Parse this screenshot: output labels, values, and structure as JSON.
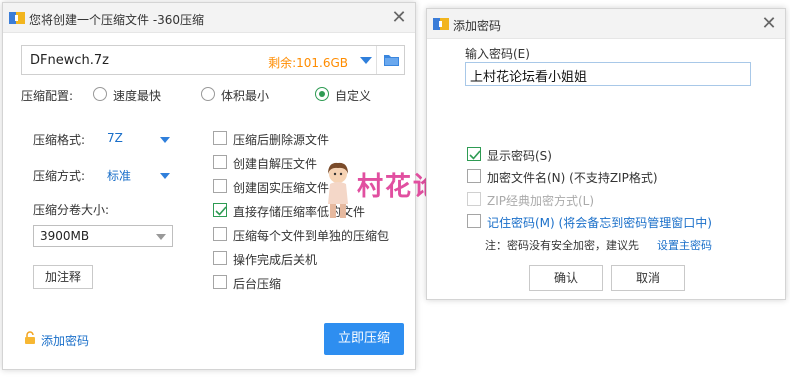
{
  "compress_dialog": {
    "title": "您将创建一个压缩文件 -360压缩",
    "path_value": "DFnewch.7z",
    "free_space": "剩余:101.6GB",
    "config_label": "压缩配置:",
    "radio_options": [
      "速度最快",
      "体积最小",
      "自定义"
    ],
    "radio_selected": "自定义",
    "format_label": "压缩格式:",
    "format_value": "7Z",
    "method_label": "压缩方式:",
    "method_value": "标准",
    "volume_label": "压缩分卷大小:",
    "volume_value": "3900MB",
    "comment_button": "加注释",
    "options": [
      {
        "label": "压缩后删除源文件",
        "checked": false
      },
      {
        "label": "创建自解压文件",
        "checked": false
      },
      {
        "label": "创建固实压缩文件",
        "checked": false
      },
      {
        "label": "直接存储压缩率低的文件",
        "checked": true
      },
      {
        "label": "压缩每个文件到单独的压缩包",
        "checked": false
      },
      {
        "label": "操作完成后关机",
        "checked": false
      },
      {
        "label": "后台压缩",
        "checked": false
      }
    ],
    "add_password_link": "添加密码",
    "compress_now_button": "立即压缩"
  },
  "password_dialog": {
    "title": "添加密码",
    "input_label": "输入密码(E)",
    "password_value": "上村花论坛看小姐姐",
    "show_password": {
      "label": "显示密码(S)",
      "checked": true
    },
    "encrypt_names": {
      "label": "加密文件名(N) (不支持ZIP格式)",
      "checked": false
    },
    "zip_classic": {
      "label": "ZIP经典加密方式(L)",
      "checked": false,
      "disabled": true
    },
    "remember": {
      "label": "记住密码(M) (将会备忘到密码管理窗口中)",
      "checked": false
    },
    "note_prefix": "注：密码没有安全加密，建议先",
    "note_link": "设置主密码",
    "ok_button": "确认",
    "cancel_button": "取消"
  },
  "watermark": {
    "text": "村花论坛"
  },
  "colors": {
    "accent": "#2e8ef0",
    "check": "#2e9b53",
    "free_space": "#ff8c00",
    "link": "#1a6fc9",
    "watermark": "#e14fa0"
  }
}
